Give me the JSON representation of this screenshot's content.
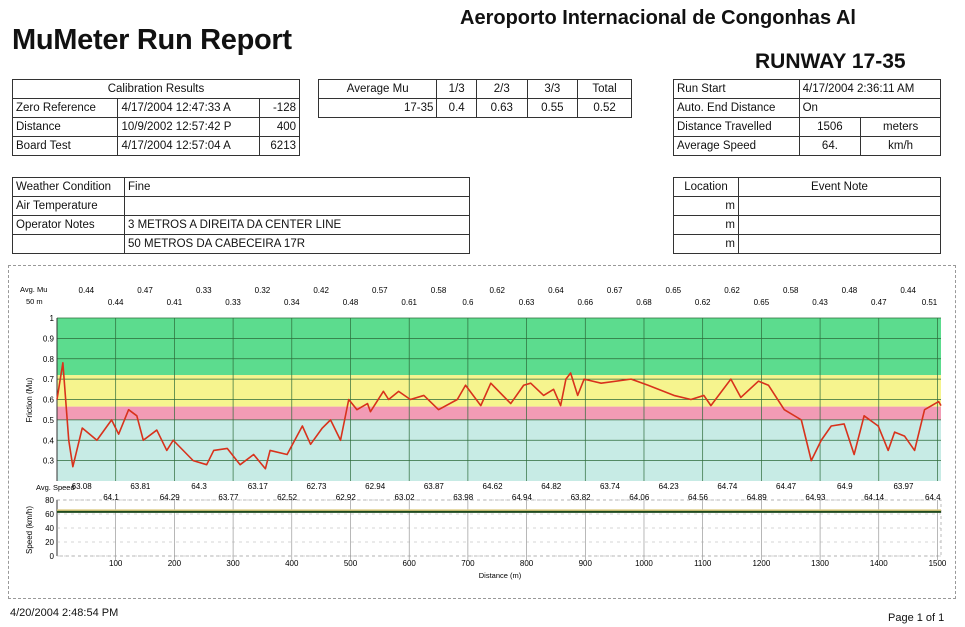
{
  "header": {
    "title": "MuMeter Run Report",
    "airport": "Aeroporto Internacional de Congonhas Al",
    "runway": "RUNWAY 17-35"
  },
  "calibration": {
    "heading": "Calibration Results",
    "rows": [
      {
        "label": "Zero Reference",
        "date": "4/17/2004 12:47:33 A",
        "value": "-128"
      },
      {
        "label": "Distance",
        "date": "10/9/2002 12:57:42 P",
        "value": "400"
      },
      {
        "label": "Board Test",
        "date": "4/17/2004 12:57:04 A",
        "value": "6213"
      }
    ]
  },
  "average_mu": {
    "headers": [
      "Average Mu",
      "1/3",
      "2/3",
      "3/3",
      "Total"
    ],
    "row": [
      "17-35",
      "0.4",
      "0.63",
      "0.55",
      "0.52"
    ]
  },
  "run_info": {
    "run_start_label": "Run Start",
    "run_start": "4/17/2004 2:36:11 AM",
    "auto_end_label": "Auto. End Distance",
    "auto_end": "On",
    "distance_label": "Distance Travelled",
    "distance": "1506",
    "distance_unit": "meters",
    "speed_label": "Average Speed",
    "speed": "64.",
    "speed_unit": "km/h"
  },
  "weather": {
    "condition_label": "Weather Condition",
    "condition": "Fine",
    "air_temp_label": "Air Temperature",
    "air_temp": "",
    "notes_label": "Operator Notes",
    "notes_line1": "3 METROS A DIREITA DA CENTER LINE",
    "notes_line2": "50 METROS DA CABECEIRA 17R"
  },
  "events": {
    "location_header": "Location",
    "note_header": "Event Note",
    "rows": [
      {
        "location": "m",
        "note": ""
      },
      {
        "location": "m",
        "note": ""
      },
      {
        "location": "m",
        "note": ""
      }
    ]
  },
  "footer": {
    "printed": "4/20/2004 2:48:54 PM",
    "page": "Page 1 of 1"
  },
  "chart_data": {
    "type": "line",
    "friction": {
      "ylabel": "Friction (Mu)",
      "ylim": [
        0.2,
        1.0
      ],
      "yticks": [
        "0.3",
        "0.4",
        "0.5",
        "0.6",
        "0.7",
        "0.8",
        "0.9",
        "1"
      ],
      "bands": [
        {
          "from": 0.72,
          "to": 1.0,
          "color": "#3fd67a"
        },
        {
          "from": 0.565,
          "to": 0.72,
          "color": "#f4f27a"
        },
        {
          "from": 0.5,
          "to": 0.565,
          "color": "#f08aa8"
        },
        {
          "from": 0.2,
          "to": 0.5,
          "color": "#bde8e0"
        }
      ],
      "line_color": "#d8321c",
      "points": [
        [
          0,
          0.6
        ],
        [
          10,
          0.78
        ],
        [
          20,
          0.4
        ],
        [
          27,
          0.27
        ],
        [
          43,
          0.46
        ],
        [
          68,
          0.4
        ],
        [
          93,
          0.5
        ],
        [
          105,
          0.43
        ],
        [
          122,
          0.55
        ],
        [
          136,
          0.52
        ],
        [
          147,
          0.4
        ],
        [
          170,
          0.45
        ],
        [
          187,
          0.35
        ],
        [
          198,
          0.4
        ],
        [
          232,
          0.3
        ],
        [
          255,
          0.28
        ],
        [
          267,
          0.35
        ],
        [
          290,
          0.36
        ],
        [
          312,
          0.28
        ],
        [
          335,
          0.33
        ],
        [
          355,
          0.26
        ],
        [
          363,
          0.35
        ],
        [
          392,
          0.33
        ],
        [
          418,
          0.47
        ],
        [
          432,
          0.38
        ],
        [
          452,
          0.46
        ],
        [
          466,
          0.5
        ],
        [
          483,
          0.4
        ],
        [
          497,
          0.6
        ],
        [
          511,
          0.55
        ],
        [
          529,
          0.58
        ],
        [
          534,
          0.54
        ],
        [
          556,
          0.64
        ],
        [
          565,
          0.6
        ],
        [
          582,
          0.64
        ],
        [
          602,
          0.6
        ],
        [
          625,
          0.62
        ],
        [
          650,
          0.55
        ],
        [
          682,
          0.6
        ],
        [
          696,
          0.67
        ],
        [
          722,
          0.57
        ],
        [
          739,
          0.68
        ],
        [
          773,
          0.58
        ],
        [
          795,
          0.67
        ],
        [
          807,
          0.68
        ],
        [
          829,
          0.62
        ],
        [
          846,
          0.65
        ],
        [
          858,
          0.57
        ],
        [
          867,
          0.7
        ],
        [
          875,
          0.73
        ],
        [
          887,
          0.62
        ],
        [
          898,
          0.7
        ],
        [
          927,
          0.68
        ],
        [
          978,
          0.7
        ],
        [
          1007,
          0.67
        ],
        [
          1051,
          0.62
        ],
        [
          1080,
          0.6
        ],
        [
          1102,
          0.62
        ],
        [
          1114,
          0.57
        ],
        [
          1148,
          0.7
        ],
        [
          1165,
          0.61
        ],
        [
          1195,
          0.69
        ],
        [
          1212,
          0.67
        ],
        [
          1239,
          0.55
        ],
        [
          1268,
          0.5
        ],
        [
          1285,
          0.3
        ],
        [
          1302,
          0.4
        ],
        [
          1319,
          0.47
        ],
        [
          1341,
          0.48
        ],
        [
          1358,
          0.33
        ],
        [
          1375,
          0.52
        ],
        [
          1399,
          0.47
        ],
        [
          1416,
          0.35
        ],
        [
          1427,
          0.44
        ],
        [
          1444,
          0.42
        ],
        [
          1461,
          0.35
        ],
        [
          1478,
          0.55
        ],
        [
          1502,
          0.59
        ],
        [
          1506,
          0.57
        ]
      ],
      "avg_label": "Avg. Mu",
      "segment_label": "50 m",
      "segment_avgs": [
        "0.44",
        "0.44",
        "0.47",
        "0.41",
        "0.33",
        "0.33",
        "0.32",
        "0.34",
        "0.42",
        "0.48",
        "0.57",
        "0.61",
        "0.58",
        "0.6",
        "0.62",
        "0.63",
        "0.64",
        "0.66",
        "0.67",
        "0.68",
        "0.65",
        "0.62",
        "0.62",
        "0.65",
        "0.58",
        "0.43",
        "0.48",
        "0.47",
        "0.44",
        "0.51"
      ]
    },
    "speed": {
      "ylabel": "Speed (km/h)",
      "ylim": [
        0,
        80
      ],
      "yticks": [
        "0",
        "20",
        "40",
        "60",
        "80"
      ],
      "value": 63,
      "line_color": "#1e4a1e",
      "avg_label": "Avg. Speed",
      "segment_avgs": [
        "63.08",
        "64.1",
        "63.81",
        "64.29",
        "64.3",
        "63.77",
        "63.17",
        "62.52",
        "62.73",
        "62.92",
        "62.94",
        "63.02",
        "63.87",
        "63.98",
        "64.62",
        "64.94",
        "64.82",
        "63.82",
        "63.74",
        "64.06",
        "64.23",
        "64.56",
        "64.74",
        "64.89",
        "64.47",
        "64.93",
        "64.9",
        "64.14",
        "63.97",
        "64.4"
      ]
    },
    "xlabel": "Distance (m)",
    "xlim": [
      0,
      1506
    ],
    "xticks": [
      "100",
      "200",
      "300",
      "400",
      "500",
      "600",
      "700",
      "800",
      "900",
      "1000",
      "1100",
      "1200",
      "1300",
      "1400",
      "1500"
    ],
    "grid": true
  }
}
